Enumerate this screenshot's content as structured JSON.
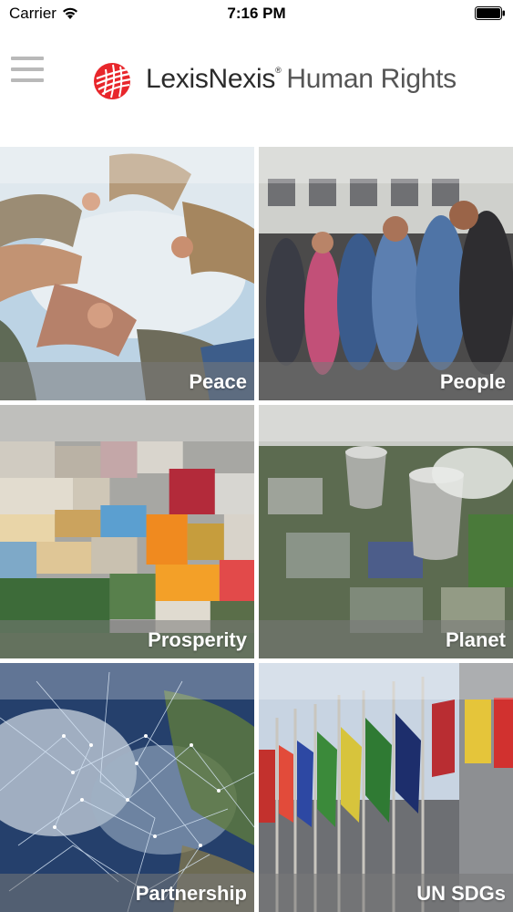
{
  "status_bar": {
    "carrier": "Carrier",
    "time": "7:16 PM"
  },
  "header": {
    "logo_brand": "LexisNexis",
    "logo_reg": "®",
    "logo_product": "Human Rights",
    "menu_icon": "hamburger-menu-icon",
    "logo_mark_color": "#e8262b"
  },
  "tiles": [
    {
      "label": "Peace"
    },
    {
      "label": "People"
    },
    {
      "label": "Prosperity"
    },
    {
      "label": "Planet"
    },
    {
      "label": "Partnership"
    },
    {
      "label": "UN SDGs"
    }
  ]
}
